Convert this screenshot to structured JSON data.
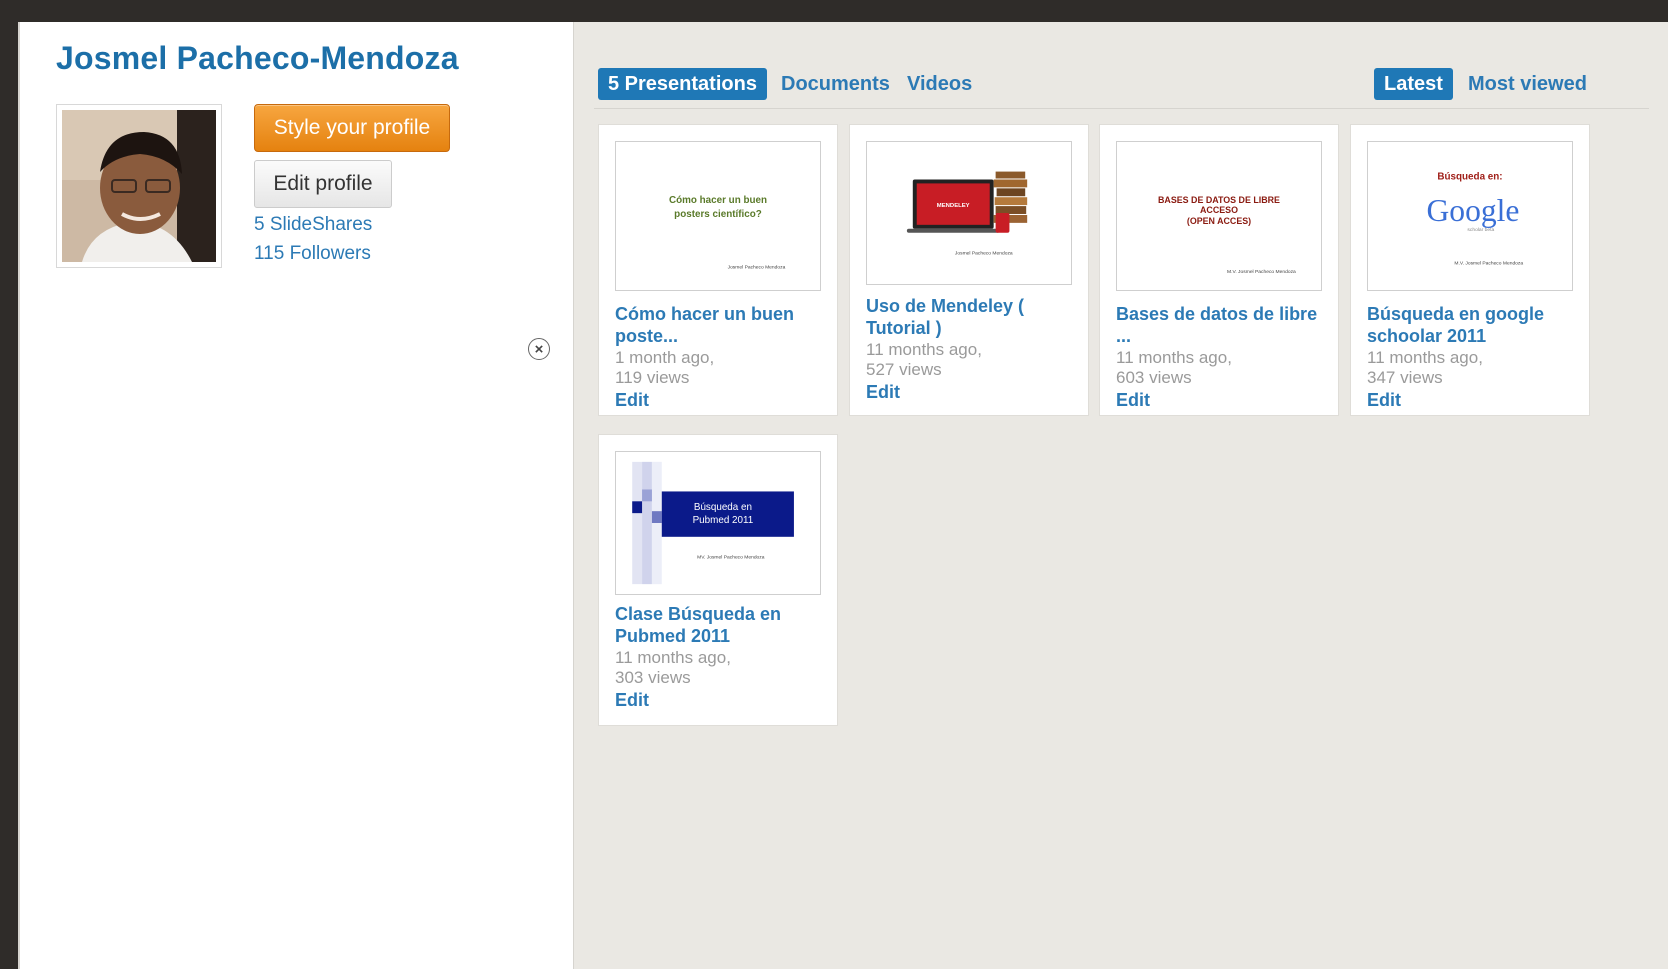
{
  "profile": {
    "name": "Josmel Pacheco-Mendoza",
    "style_button": "Style your profile",
    "edit_button": "Edit profile",
    "slideshares": "5 SlideShares",
    "followers": "115 Followers"
  },
  "tabs": {
    "presentations": "5 Presentations",
    "documents": "Documents",
    "videos": "Videos",
    "latest": "Latest",
    "most_viewed": "Most viewed"
  },
  "close_symbol": "×",
  "presentations": [
    {
      "title": "Cómo hacer un buen poste...",
      "time": "1 month ago,",
      "views": "119 views",
      "edit": "Edit",
      "thumb": {
        "line1": "Cómo hacer un buen",
        "line2": "posters científico?",
        "author": "Josmel Pacheco Mendoza"
      }
    },
    {
      "title": "Uso de Mendeley ( Tutorial )",
      "time": "11 months ago,",
      "views": "527 views",
      "edit": "Edit",
      "thumb": {
        "brand": "MENDELEY",
        "author": "Josmel Pacheco Mendoza"
      }
    },
    {
      "title": "Bases de datos de libre ...",
      "time": "11 months ago,",
      "views": "603 views",
      "edit": "Edit",
      "thumb": {
        "line1": "BASES DE DATOS DE LIBRE",
        "line2": "ACCESO",
        "line3": "(OPEN ACCES)",
        "author": "M.V. Josmel Pacheco Mendoza"
      }
    },
    {
      "title": "Búsqueda en google schoolar 2011",
      "time": "11 months ago,",
      "views": "347 views",
      "edit": "Edit",
      "thumb": {
        "heading": "Búsqueda en:",
        "logo": "Google",
        "sub": "scholar beta",
        "author": "M.V. Josmel Pacheco Mendoza"
      }
    },
    {
      "title": "Clase Búsqueda en Pubmed 2011",
      "time": "11 months ago,",
      "views": "303 views",
      "edit": "Edit",
      "thumb": {
        "line1": "Búsqueda en",
        "line2": "Pubmed 2011",
        "author": "MV. Josmel Pacheco Mendoza"
      }
    }
  ],
  "colors": {
    "link": "#2c7ab5",
    "heading": "#1c6fa8",
    "orange_button": "#e5820f",
    "panel_bg": "#eae8e3",
    "active_tab": "#1f78b6"
  }
}
